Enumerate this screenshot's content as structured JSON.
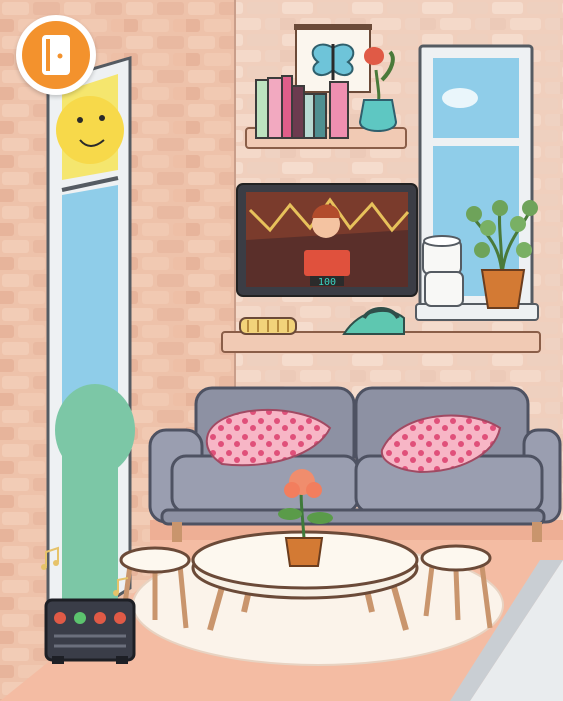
{
  "hud": {
    "exit_icon": "door-exit-icon",
    "accent_color": "#f3922d"
  },
  "tv": {
    "score_text": "100"
  },
  "palette": {
    "wall_brick": "#eec7b0",
    "brick_line": "#d9a690",
    "floor": "#f2b9a0",
    "sofa": "#8d91a3",
    "pillow": "#f4a6b8",
    "window_frame": "#eef1f3",
    "sky": "#8fcde9"
  }
}
